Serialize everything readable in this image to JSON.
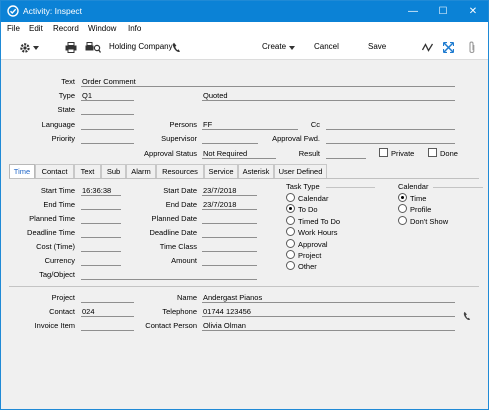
{
  "window": {
    "title": "Activity: Inspect",
    "minimize": "—",
    "maximize": "☐",
    "close": "✕"
  },
  "menu": [
    "File",
    "Edit",
    "Record",
    "Window",
    "Info"
  ],
  "toolbar": {
    "company": "Holding Company",
    "create": "Create",
    "cancel": "Cancel",
    "save": "Save"
  },
  "header": {
    "text_label": "Text",
    "text_value": "Order Comment",
    "type_label": "Type",
    "type_value": "Q1",
    "type_desc": "Quoted",
    "state_label": "State",
    "state_value": "",
    "language_label": "Language",
    "language_value": "",
    "persons_label": "Persons",
    "persons_value": "FF",
    "cc_label": "Cc",
    "cc_value": "",
    "priority_label": "Priority",
    "priority_value": "",
    "supervisor_label": "Supervisor",
    "supervisor_value": "",
    "approval_fwd_label": "Approval Fwd.",
    "approval_fwd_value": "",
    "approval_status_label": "Approval Status",
    "approval_status_value": "Not Required",
    "result_label": "Result",
    "result_value": "",
    "private_label": "Private",
    "done_label": "Done"
  },
  "tabs": [
    "Time",
    "Contact",
    "Text",
    "Sub",
    "Alarm",
    "Resources",
    "Service",
    "Asterisk",
    "User Defined"
  ],
  "time": {
    "start_time_label": "Start Time",
    "start_time": "16:36:38",
    "end_time_label": "End Time",
    "end_time": "",
    "planned_time_label": "Planned Time",
    "planned_time": "",
    "deadline_time_label": "Deadline Time",
    "deadline_time": "",
    "cost_label": "Cost (Time)",
    "cost": "",
    "currency_label": "Currency",
    "currency": "",
    "tag_label": "Tag/Object",
    "tag": "",
    "start_date_label": "Start Date",
    "start_date": "23/7/2018",
    "end_date_label": "End Date",
    "end_date": "23/7/2018",
    "planned_date_label": "Planned Date",
    "planned_date": "",
    "deadline_date_label": "Deadline Date",
    "deadline_date": "",
    "time_class_label": "Time Class",
    "time_class": "",
    "amount_label": "Amount",
    "amount": ""
  },
  "task_type": {
    "label": "Task Type",
    "options": [
      "Calendar",
      "To Do",
      "Timed To Do",
      "Work Hours",
      "Approval",
      "Project",
      "Other"
    ],
    "selected": "To Do"
  },
  "calendar": {
    "label": "Calendar",
    "options": [
      "Time",
      "Profile",
      "Don't Show"
    ],
    "selected": "Time"
  },
  "footer": {
    "project_label": "Project",
    "project": "",
    "contact_label": "Contact",
    "contact": "024",
    "invoice_item_label": "Invoice Item",
    "invoice_item": "",
    "name_label": "Name",
    "name": "Andergast Pianos",
    "telephone_label": "Telephone",
    "telephone": "01744 123456",
    "contact_person_label": "Contact Person",
    "contact_person": "Olivia Olman"
  }
}
